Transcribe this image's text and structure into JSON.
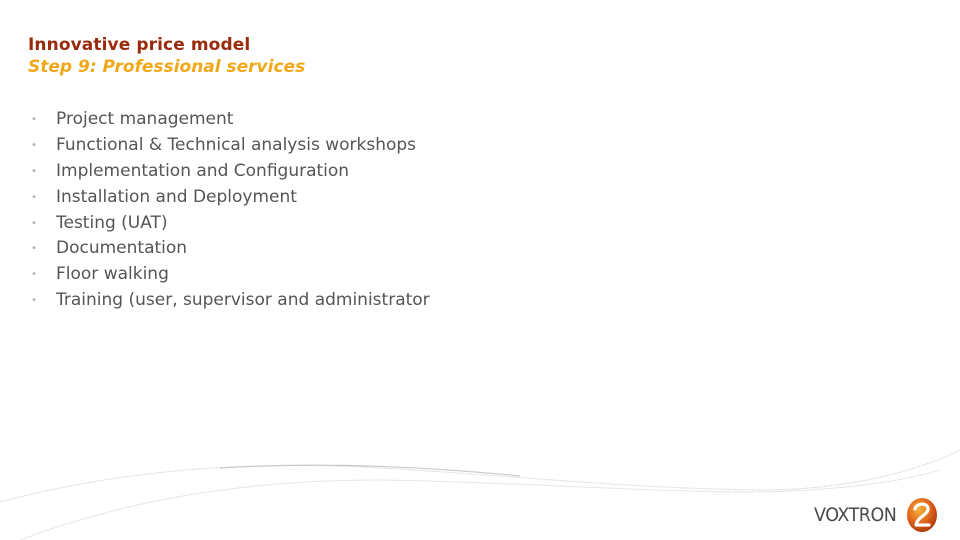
{
  "slide": {
    "title": "Innovative price model",
    "subtitle": "Step 9: Professional services",
    "colors": {
      "title": "#9a2a0c",
      "subtitle": "#f0a818",
      "body_text": "#555555",
      "bullet": "#b0b0b0"
    },
    "bullets": [
      "Project management",
      "Functional & Technical analysis workshops",
      "Implementation and Configuration",
      "Installation and Deployment",
      "Testing (UAT)",
      "Documentation",
      "Floor walking",
      "Training (user, supervisor and administrator"
    ],
    "bullet_glyph": "•"
  },
  "logo": {
    "text": "VOXTRON",
    "icon": "voxtron-swirl-icon"
  }
}
